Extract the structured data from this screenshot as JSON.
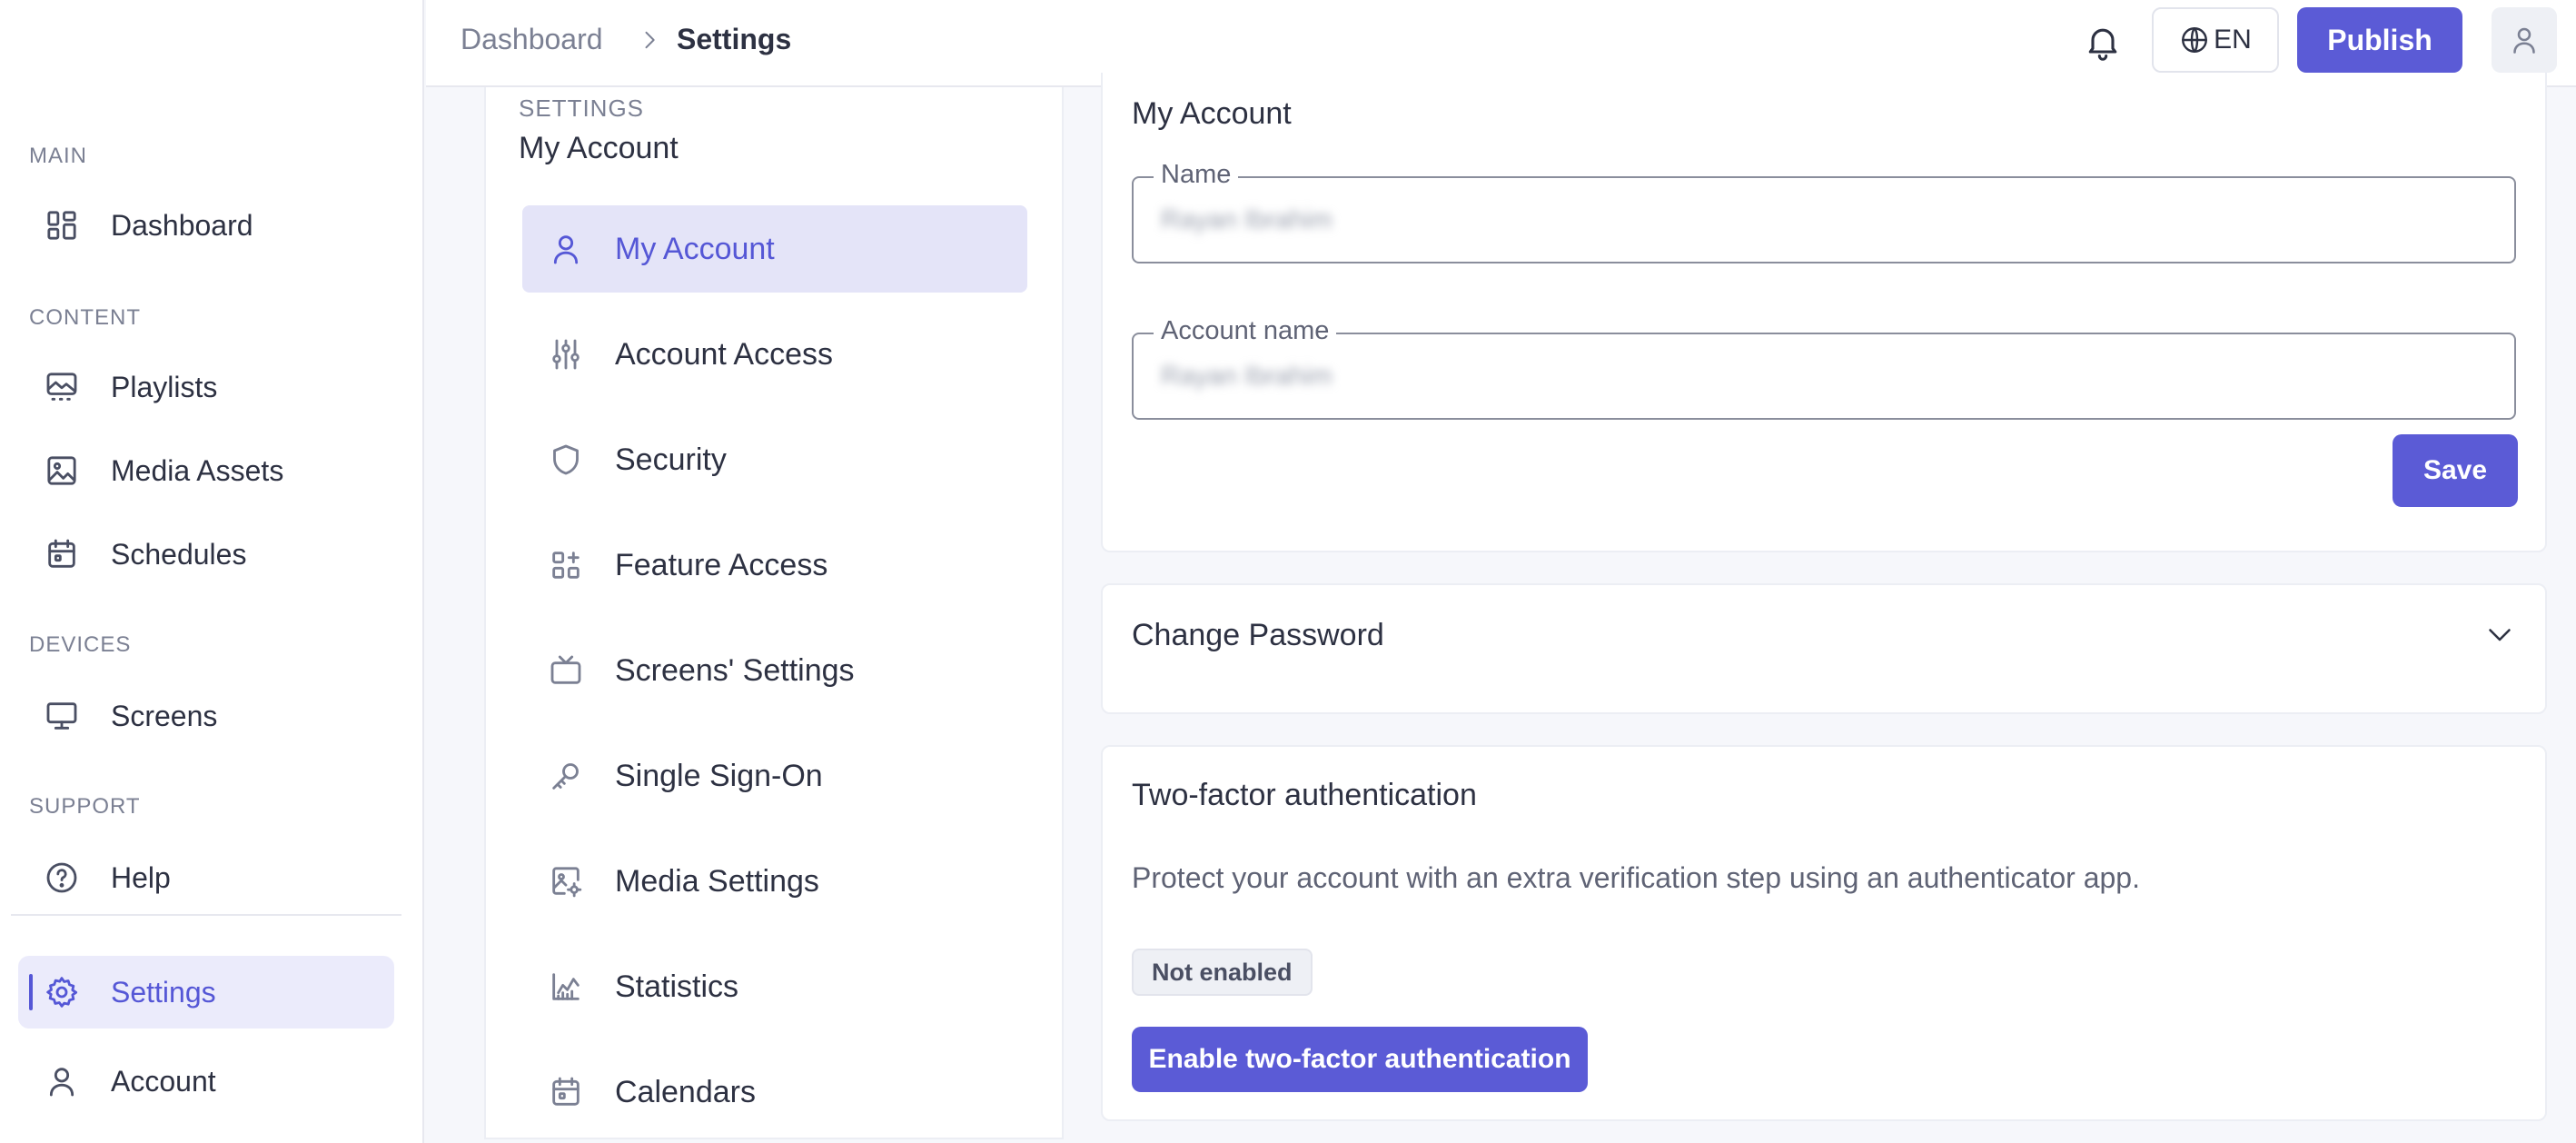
{
  "sidebar": {
    "sections": {
      "main": "MAIN",
      "content": "CONTENT",
      "devices": "DEVICES",
      "support": "SUPPORT"
    },
    "items": {
      "dashboard": {
        "label": "Dashboard",
        "icon": "dashboard-grid-icon"
      },
      "playlists": {
        "label": "Playlists",
        "icon": "playlist-icon"
      },
      "media_assets": {
        "label": "Media Assets",
        "icon": "image-icon"
      },
      "schedules": {
        "label": "Schedules",
        "icon": "calendar-icon"
      },
      "screens": {
        "label": "Screens",
        "icon": "monitor-icon"
      },
      "help": {
        "label": "Help",
        "icon": "help-circle-icon"
      },
      "settings": {
        "label": "Settings",
        "icon": "gear-icon",
        "active": true
      },
      "account": {
        "label": "Account",
        "icon": "user-icon"
      }
    }
  },
  "header": {
    "breadcrumb": {
      "parent": "Dashboard",
      "current": "Settings"
    },
    "language": "EN",
    "publish_label": "Publish"
  },
  "settings_nav": {
    "eyebrow": "SETTINGS",
    "title": "My Account",
    "items": [
      {
        "label": "My Account",
        "icon": "user-icon",
        "active": true
      },
      {
        "label": "Account Access",
        "icon": "sliders-icon"
      },
      {
        "label": "Security",
        "icon": "shield-icon"
      },
      {
        "label": "Feature Access",
        "icon": "apps-plus-icon"
      },
      {
        "label": "Screens' Settings",
        "icon": "tv-icon"
      },
      {
        "label": "Single Sign-On",
        "icon": "key-icon"
      },
      {
        "label": "Media Settings",
        "icon": "image-settings-icon"
      },
      {
        "label": "Statistics",
        "icon": "chart-icon"
      },
      {
        "label": "Calendars",
        "icon": "calendar-icon"
      }
    ]
  },
  "my_account": {
    "title": "My Account",
    "name_label": "Name",
    "name_value": "Rayan Ibrahim",
    "account_name_label": "Account name",
    "account_name_value": "Rayan Ibrahim",
    "save_label": "Save"
  },
  "change_password": {
    "title": "Change Password"
  },
  "two_factor": {
    "title": "Two-factor authentication",
    "description": "Protect your account with an extra verification step using an authenticator app.",
    "status": "Not enabled",
    "enable_label": "Enable two-factor authentication"
  },
  "colors": {
    "accent": "#5b5bd6",
    "active_bg": "#e4e4f8",
    "text": "#2d3142",
    "muted": "#7b8093"
  }
}
